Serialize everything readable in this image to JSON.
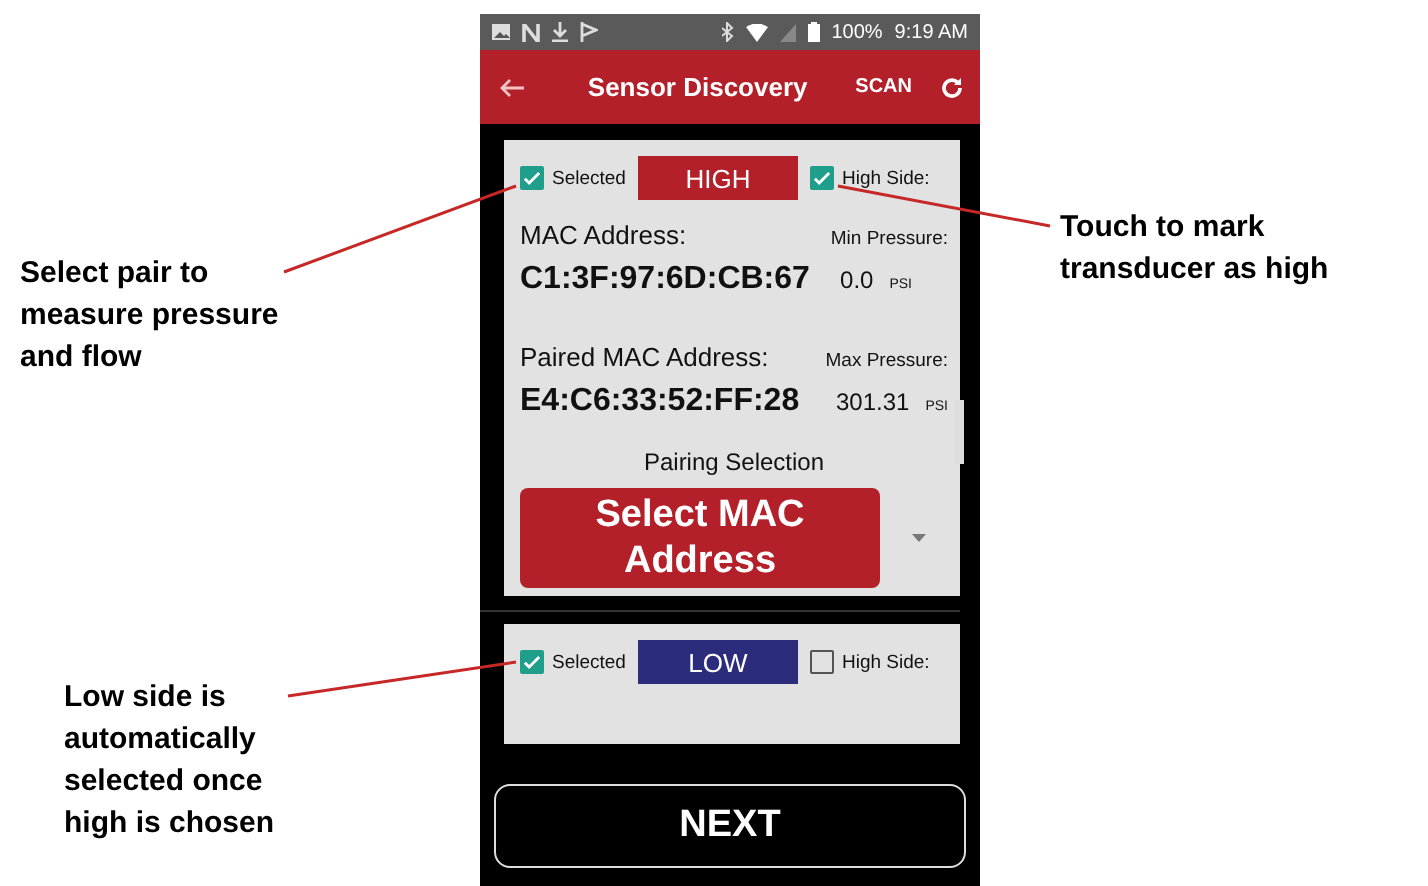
{
  "status_bar": {
    "battery": "100%",
    "time": "9:19 AM"
  },
  "app_bar": {
    "title": "Sensor Discovery",
    "action": "SCAN"
  },
  "sensors": [
    {
      "selected": true,
      "selected_label": "Selected",
      "side_label": "HIGH",
      "color": "#b3202a",
      "high_side": true,
      "high_side_label": "High Side:",
      "details": {
        "mac_label": "MAC Address:",
        "mac": "C1:3F:97:6D:CB:67",
        "min_label": "Min Pressure:",
        "min_value": "0.0",
        "min_unit": "PSI",
        "paired_label": "Paired MAC Address:",
        "paired_mac": "E4:C6:33:52:FF:28",
        "max_label": "Max Pressure:",
        "max_value": "301.31",
        "max_unit": "PSI",
        "pairing_label": "Pairing Selection",
        "pairing_button": "Select MAC Address"
      }
    },
    {
      "selected": true,
      "selected_label": "Selected",
      "side_label": "LOW",
      "color": "#2b2d7c",
      "high_side": false,
      "high_side_label": "High Side:"
    }
  ],
  "next_button": "NEXT",
  "annotations": [
    {
      "text": "Select pair to measure pressure and flow"
    },
    {
      "text": "Touch to mark transducer as high"
    },
    {
      "text": "Low side is automatically selected once high is chosen"
    }
  ]
}
